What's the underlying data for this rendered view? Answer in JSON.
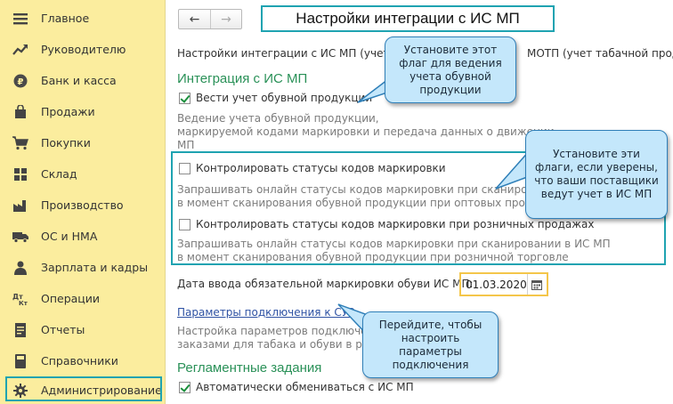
{
  "sidebar": {
    "items": [
      {
        "label": "Главное",
        "icon": "menu-icon"
      },
      {
        "label": "Руководителю",
        "icon": "trend-icon"
      },
      {
        "label": "Банк и касса",
        "icon": "ruble-coin-icon"
      },
      {
        "label": "Продажи",
        "icon": "shopping-bag-icon"
      },
      {
        "label": "Покупки",
        "icon": "cart-icon"
      },
      {
        "label": "Склад",
        "icon": "warehouse-icon"
      },
      {
        "label": "Производство",
        "icon": "factory-icon"
      },
      {
        "label": "ОС и НМА",
        "icon": "truck-icon"
      },
      {
        "label": "Зарплата и кадры",
        "icon": "person-icon"
      },
      {
        "label": "Операции",
        "icon": "dt-kt-icon"
      },
      {
        "label": "Отчеты",
        "icon": "report-icon"
      },
      {
        "label": "Справочники",
        "icon": "book-icon"
      },
      {
        "label": "Администрирование",
        "icon": "gear-icon"
      }
    ],
    "active_index": 12
  },
  "header": {
    "back": "←",
    "forward": "→",
    "title": "Настройки интеграции с ИС МП"
  },
  "intro_text": "Настройки интеграции с ИС МП (учет о",
  "intro_text_right": "МОТП (учет табачной продук",
  "section_integration": "Интеграция с ИС МП",
  "shoes_checkbox": {
    "label": "Вести учет обувной продукции",
    "checked": true
  },
  "shoes_desc": [
    "Ведение учета обувной продукции,",
    "маркируемой кодами маркировки и передача данных о движении",
    "МП"
  ],
  "wholesale_checkbox": {
    "label": "Контролировать статусы кодов маркировки",
    "checked": false
  },
  "wholesale_desc": [
    "Запрашивать онлайн статусы кодов маркировки при сканировани",
    "в момент сканирования обувной продукции при оптовых продаж"
  ],
  "retail_checkbox": {
    "label": "Контролировать статусы кодов маркировки при розничных продажах",
    "checked": false
  },
  "retail_desc": [
    "Запрашивать онлайн статусы кодов маркировки при сканировании в ИС МП",
    "в момент сканирования обувной продукции при розничной торговле"
  ],
  "date_label": "Дата ввода обязательной маркировки обуви ИС МП:",
  "date_value": "01.03.2020",
  "suz_link": "Параметры подключения к СУЗ",
  "suz_desc": [
    "Настройка параметров подключе",
    "заказами для табака и обуви в раз"
  ],
  "section_tasks": "Регламентные задания",
  "exchange_checkbox": {
    "label": "Автоматически обмениваться с ИС МП",
    "checked": true
  },
  "callouts": {
    "flag": "Установите этот флаг для ведения учета обувной продукции",
    "flags": "Установите эти флаги, если уверены, что ваши поставщики ведут учет в ИС МП",
    "params": "Перейдите, чтобы настроить параметры подключения"
  },
  "colors": {
    "sidebar_bg": "#fbed9e",
    "accent_teal": "#1fa3b1",
    "section_green": "#2a9158",
    "link_blue": "#2d51a3",
    "callout_bg": "#c4e7fb",
    "date_highlight": "#f4c64a"
  }
}
